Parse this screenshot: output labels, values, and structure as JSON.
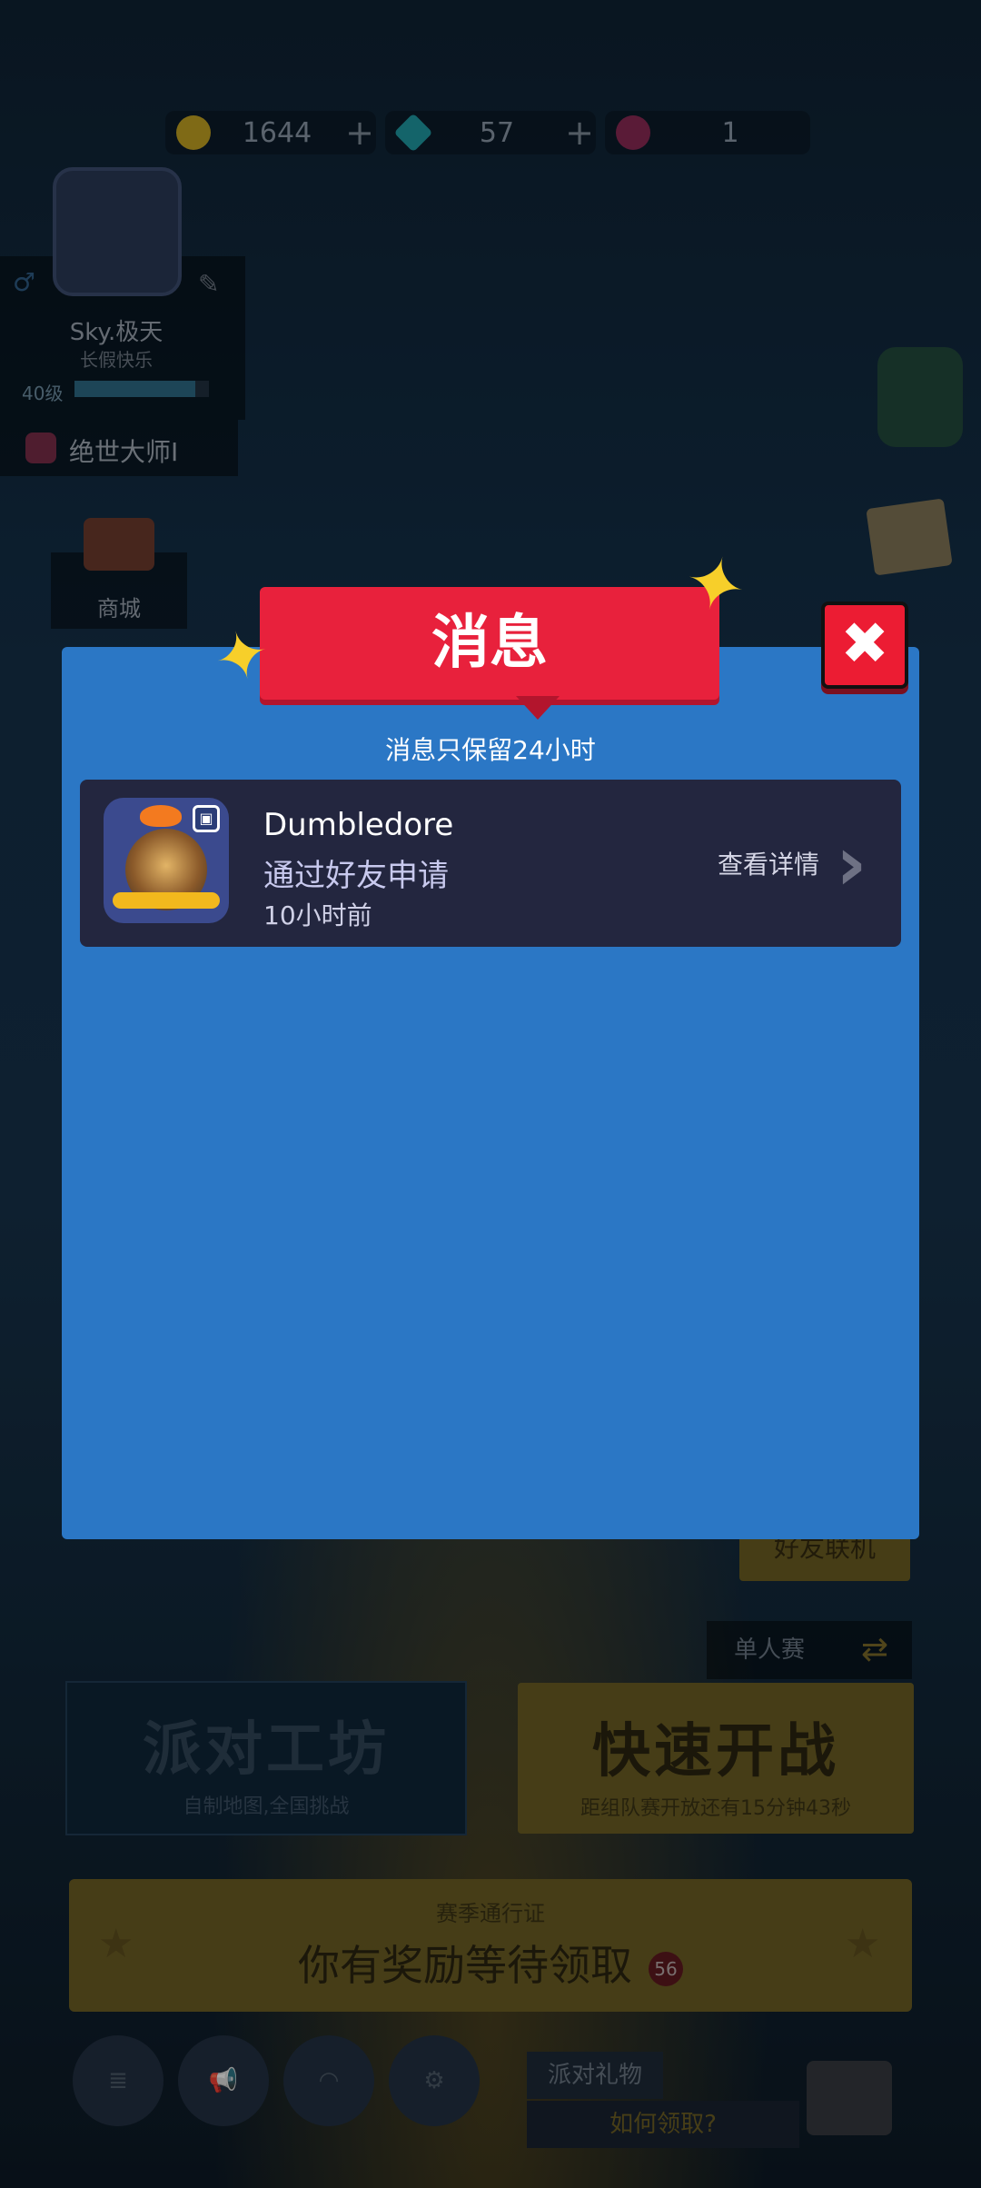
{
  "currency": {
    "coins": "1644",
    "gems": "57",
    "tickets": "1",
    "plus": "+"
  },
  "profile": {
    "name": "Sky.极天",
    "subtitle": "长假快乐",
    "level": "40级",
    "level_progress": 0.9,
    "rank": "绝世大师I"
  },
  "shop": {
    "label": "商城"
  },
  "background_buttons": {
    "friend_play": "好友联机",
    "single_mode": "单人赛",
    "party_workshop": {
      "title": "派对工坊",
      "subtitle": "自制地图,全国挑战"
    },
    "quick_battle": {
      "title": "快速开战",
      "subtitle": "距组队赛开放还有15分钟43秒"
    },
    "season_pass": {
      "title": "赛季通行证",
      "main": "你有奖励等待领取",
      "badge": "56"
    },
    "party_gift": {
      "label": "派对礼物",
      "how": "如何领取?"
    }
  },
  "modal": {
    "title": "消息",
    "close": "✖",
    "notice": "消息只保留24小时",
    "messages": [
      {
        "sender": "Dumbledore",
        "text": "通过好友申请",
        "time": "10小时前",
        "action": "查看详情"
      }
    ]
  },
  "colors": {
    "modal_bg": "#2b77c5",
    "title_ribbon": "#e8213c",
    "message_card": "#23263f",
    "star": "#f7cf2a"
  },
  "icons": [
    "coin-icon",
    "gem-icon",
    "ticket-icon",
    "edit-icon",
    "male-icon",
    "rank-gem-icon",
    "shop-icon",
    "close-icon",
    "qr-icon",
    "chevron-right-icon",
    "repeat-icon",
    "star-icon",
    "settings-icon",
    "headset-icon",
    "megaphone-icon",
    "chest-icon"
  ]
}
